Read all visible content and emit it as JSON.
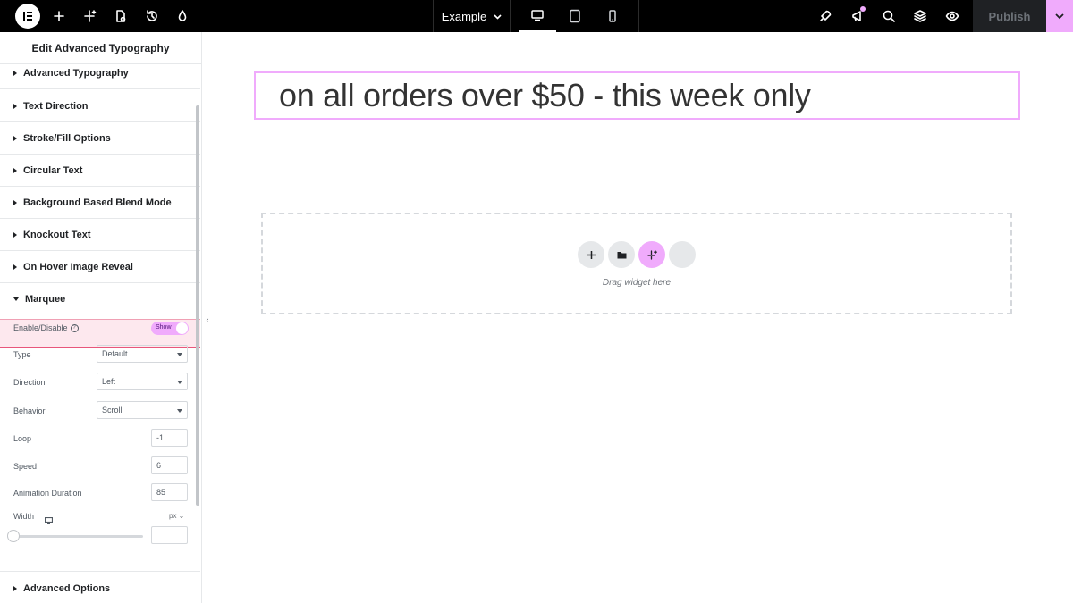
{
  "topbar": {
    "doc_name": "Example",
    "publish_label": "Publish",
    "icons": [
      "elementor-logo-icon",
      "add-icon",
      "ai-sparkle-icon",
      "page-settings-icon",
      "history-icon",
      "theme-style-icon",
      "desktop-icon",
      "tablet-icon",
      "mobile-icon",
      "rocket-icon",
      "announcement-icon",
      "search-icon",
      "layers-icon",
      "preview-eye-icon",
      "chevron-down-icon"
    ],
    "active_device": "desktop"
  },
  "panel": {
    "title": "Edit Advanced Typography",
    "sections": [
      {
        "label": "Advanced Typography",
        "expanded": false
      },
      {
        "label": "Text Direction",
        "expanded": false
      },
      {
        "label": "Stroke/Fill Options",
        "expanded": false
      },
      {
        "label": "Circular Text",
        "expanded": false
      },
      {
        "label": "Background Based Blend Mode",
        "expanded": false
      },
      {
        "label": "Knockout Text",
        "expanded": false
      },
      {
        "label": "On Hover Image Reveal",
        "expanded": false
      },
      {
        "label": "Marquee",
        "expanded": true
      }
    ],
    "marquee": {
      "enable_label": "Enable/Disable",
      "toggle_label": "Show",
      "type_label": "Type",
      "type_value": "Default",
      "direction_label": "Direction",
      "direction_value": "Left",
      "behavior_label": "Behavior",
      "behavior_value": "Scroll",
      "loop_label": "Loop",
      "loop_value": "-1",
      "speed_label": "Speed",
      "speed_value": "6",
      "duration_label": "Animation Duration",
      "duration_value": "85",
      "width_label": "Width",
      "width_unit": "px",
      "width_value": ""
    },
    "advanced_options_label": "Advanced Options",
    "collapse_glyph": "‹"
  },
  "canvas": {
    "heading_text": "on all orders over $50 - this week only",
    "drop_text": "Drag widget here"
  },
  "colors": {
    "accent": "#f0abfc",
    "topbar_bg": "#000000",
    "highlight": "#e8567b"
  }
}
